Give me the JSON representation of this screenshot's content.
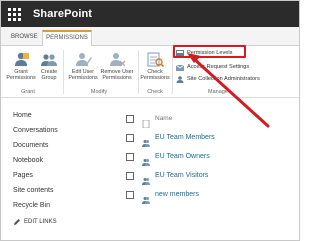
{
  "app": {
    "title": "SharePoint"
  },
  "tabs": [
    {
      "label": "BROWSE"
    },
    {
      "label": "PERMISSIONS"
    }
  ],
  "ribbon": {
    "grant": {
      "label": "Grant\nPermissions"
    },
    "create_group": {
      "label": "Create\nGroup"
    },
    "edit_user": {
      "label": "Edit User\nPermissions"
    },
    "remove_user": {
      "label": "Remove User\nPermissions"
    },
    "check": {
      "label": "Check\nPermissions"
    },
    "permission_levels": {
      "label": "Permission Levels"
    },
    "access_request": {
      "label": "Access Request Settings"
    },
    "site_collection_admins": {
      "label": "Site Collection Administrators"
    },
    "groups": {
      "grant": "Grant",
      "modify": "Modify",
      "check": "Check",
      "manage": "Manage"
    }
  },
  "nav": {
    "items": [
      "Home",
      "Conversations",
      "Documents",
      "Notebook",
      "Pages",
      "Site contents",
      "Recycle Bin"
    ],
    "edit_links": "EDIT LINKS"
  },
  "list": {
    "header": "Name",
    "rows": [
      "EU Team Members",
      "EU Team Owners",
      "EU Team Visitors",
      "new members"
    ]
  },
  "colors": {
    "suite_bar": "#2b2b2b",
    "tab_accent": "#e8972e",
    "link": "#1a6d91",
    "highlight": "#d71920"
  }
}
